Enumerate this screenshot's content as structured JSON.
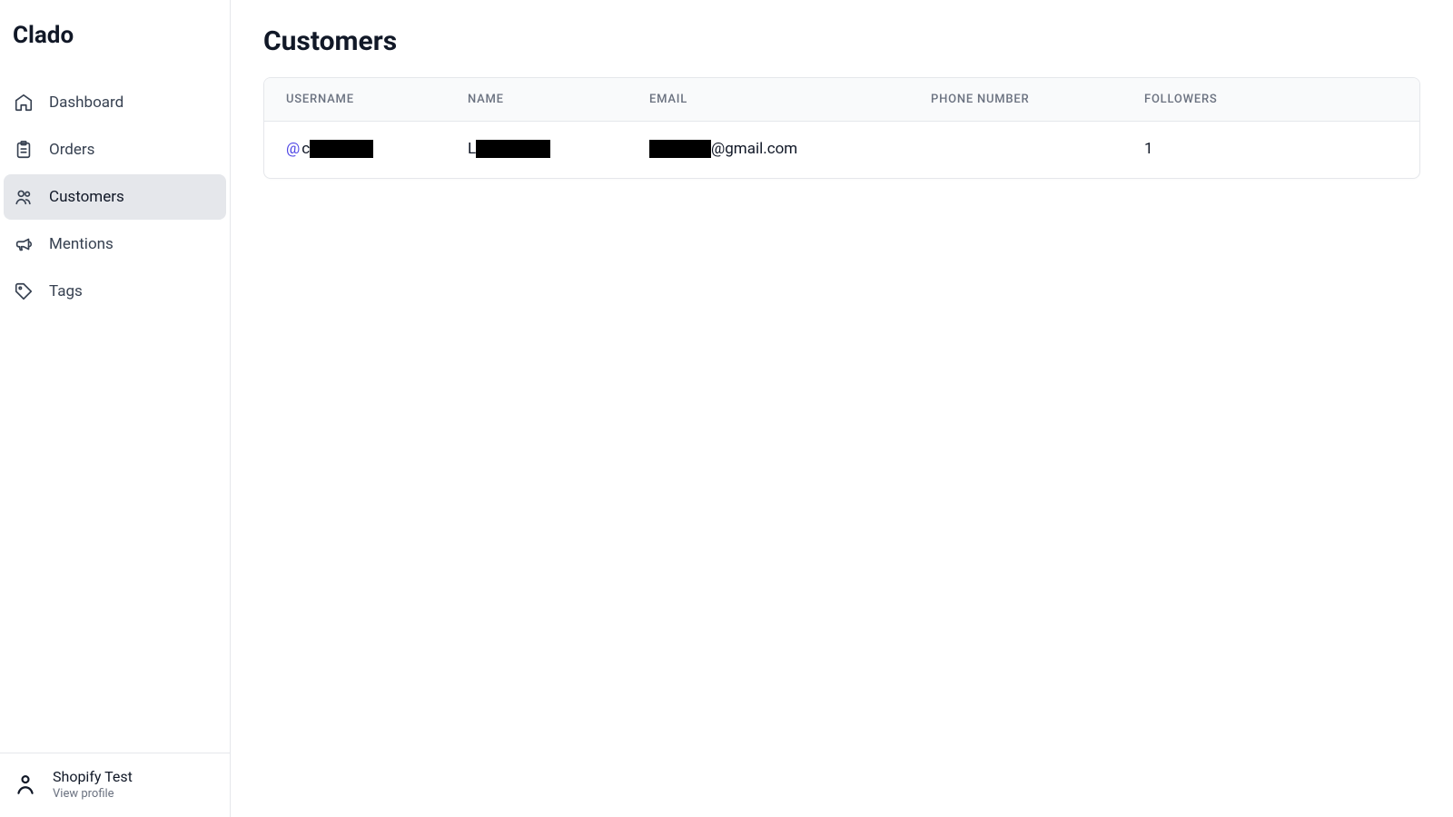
{
  "brand": "Clado",
  "sidebar": {
    "items": [
      {
        "label": "Dashboard"
      },
      {
        "label": "Orders"
      },
      {
        "label": "Customers"
      },
      {
        "label": "Mentions"
      },
      {
        "label": "Tags"
      }
    ]
  },
  "footer": {
    "name": "Shopify Test",
    "sub": "View profile"
  },
  "page": {
    "title": "Customers"
  },
  "table": {
    "headers": {
      "username": "USERNAME",
      "name": "NAME",
      "email": "EMAIL",
      "phone": "PHONE NUMBER",
      "followers": "FOLLOWERS"
    },
    "rows": [
      {
        "username_at": "@",
        "username_visible_char": "c",
        "name_visible_char": "L",
        "email_suffix": "@gmail.com",
        "phone": "",
        "followers": "1"
      }
    ]
  }
}
